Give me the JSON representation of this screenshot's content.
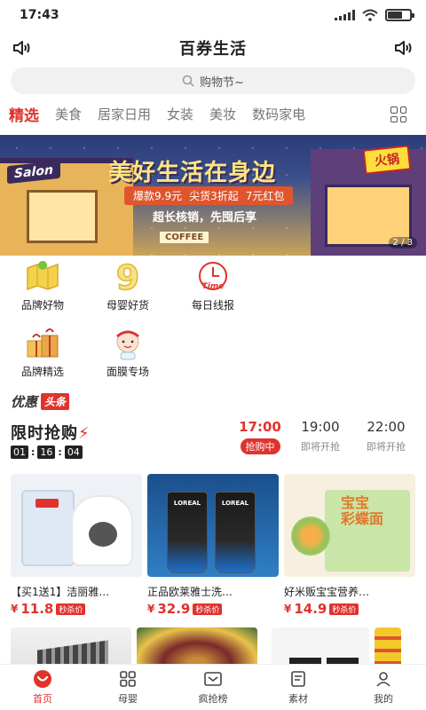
{
  "status": {
    "time": "17:43"
  },
  "header": {
    "title": "百券生活"
  },
  "search": {
    "placeholder": "购物节~"
  },
  "tabs": [
    {
      "label": "精选",
      "active": true
    },
    {
      "label": "美食"
    },
    {
      "label": "居家日用"
    },
    {
      "label": "女装"
    },
    {
      "label": "美妆"
    },
    {
      "label": "数码家电"
    }
  ],
  "banner": {
    "shop_sign": "Salon",
    "headline": "美好生活在身边",
    "offers": [
      "爆款9.9元",
      "尖货3折起",
      "7元红包"
    ],
    "slogan": "超长核销，先囤后享",
    "sign_hotpot": "火锅",
    "sign_coffee": "COFFEE",
    "pager": "2 / 3"
  },
  "quick_nav": [
    {
      "label": "品牌好物",
      "icon": "map-icon"
    },
    {
      "label": "母婴好货",
      "icon": "number-9-icon"
    },
    {
      "label": "每日线报",
      "icon": "clock-time-icon"
    },
    {
      "label": "品牌精选",
      "icon": "gift-boxes-icon"
    },
    {
      "label": "面膜专场",
      "icon": "face-mask-icon"
    }
  ],
  "headline": {
    "part1": "优惠",
    "part2": "头条"
  },
  "flash_sale": {
    "title": "限时抢购",
    "countdown": {
      "h": "01",
      "m": "16",
      "s": "04"
    },
    "slots": [
      {
        "time": "17:00",
        "status": "抢购中",
        "active": true
      },
      {
        "time": "19:00",
        "status": "即将开抢"
      },
      {
        "time": "22:00",
        "status": "即将开抢"
      }
    ]
  },
  "products": [
    {
      "name": "【买1送1】洁丽雅…",
      "currency": "¥",
      "price": "11.8",
      "tag": "秒杀价"
    },
    {
      "name": "正品欧莱雅士洗…",
      "currency": "¥",
      "price": "32.9",
      "tag": "秒杀价"
    },
    {
      "name": "好米贩宝宝营养…",
      "currency": "¥",
      "price": "14.9",
      "tag": "秒杀价"
    }
  ],
  "bottom_nav": [
    {
      "label": "首页",
      "icon": "home-smile-icon",
      "active": true
    },
    {
      "label": "母婴",
      "icon": "grid-icon"
    },
    {
      "label": "疯抢榜",
      "icon": "ticket-icon"
    },
    {
      "label": "素材",
      "icon": "document-icon"
    },
    {
      "label": "我的",
      "icon": "user-icon"
    }
  ],
  "colors": {
    "accent": "#e0332d"
  }
}
